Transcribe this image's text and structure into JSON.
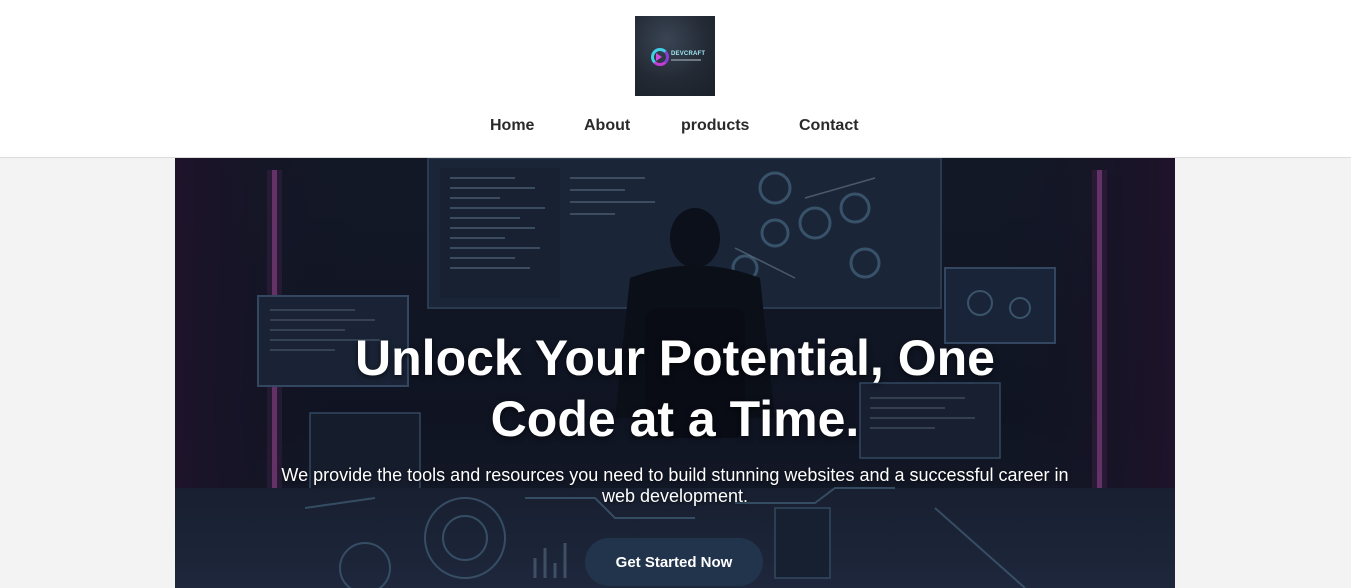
{
  "header": {
    "logo": {
      "icon": "devcraft-logo-icon",
      "wordmark": "DEVCRAFT"
    },
    "nav": [
      {
        "label": "Home"
      },
      {
        "label": "About"
      },
      {
        "label": "products"
      },
      {
        "label": "Contact"
      }
    ]
  },
  "hero": {
    "background_image": "developer-at-desk-with-code-screens",
    "title": "Unlock Your Potential, One Code at a Time.",
    "subtitle": "We provide the tools and resources you need to build stunning websites and a successful career in web development.",
    "cta_label": "Get Started Now"
  },
  "colors": {
    "header_bg": "#ffffff",
    "page_bg": "#f3f3f3",
    "nav_text": "#2a2a2a",
    "cta_bg": "#22344c",
    "accent_pink": "#c43bd6",
    "accent_cyan": "#3fd0e6"
  }
}
